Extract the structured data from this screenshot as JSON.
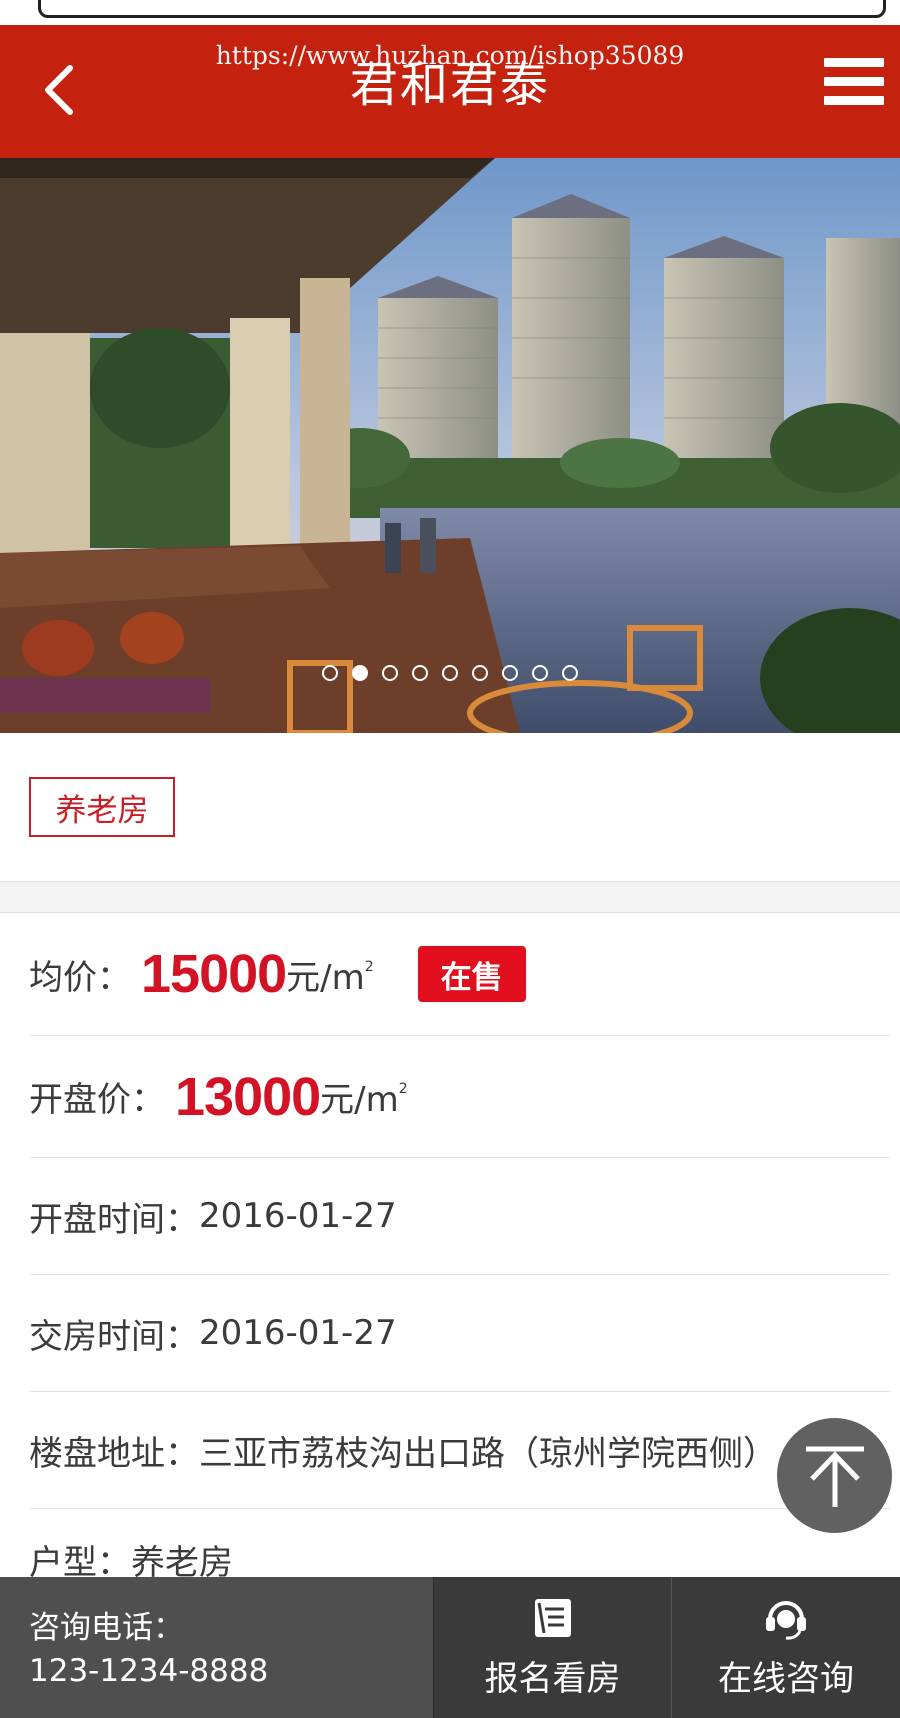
{
  "header": {
    "title": "君和君泰",
    "watermark": "https://www.huzhan.com/ishop35089",
    "back_icon": "chevron-left-icon",
    "menu_icon": "hamburger-menu-icon"
  },
  "carousel": {
    "slide_count": 9,
    "active_index": 1,
    "image_description": "high-rise residential towers by a lake viewed from a terrace"
  },
  "tag": {
    "label": "养老房"
  },
  "details": {
    "avg_price": {
      "label": "均价：",
      "value": "15000",
      "unit": "元/m",
      "unit_sup": "2",
      "status": "在售"
    },
    "open_price": {
      "label": "开盘价：",
      "value": "13000",
      "unit": "元/m",
      "unit_sup": "2"
    },
    "open_date": {
      "label": "开盘时间：",
      "value": "2016-01-27"
    },
    "delivery_date": {
      "label": "交房时间：",
      "value": "2016-01-27"
    },
    "address": {
      "label": "楼盘地址：",
      "value": "三亚市荔枝沟出口路（琼州学院西侧）"
    },
    "layout": {
      "label": "户型：",
      "value": "养老房"
    }
  },
  "footer": {
    "contact_label": "咨询电话：",
    "contact_phone": "123-1234-8888",
    "signup_label": "报名看房",
    "online_label": "在线咨询"
  },
  "colors": {
    "brand_red": "#c4210f",
    "price_red": "#d31325",
    "badge_red": "#e10f1d",
    "footer_dark": "#3a3a3a",
    "footer_gray": "#4f4f4f"
  }
}
